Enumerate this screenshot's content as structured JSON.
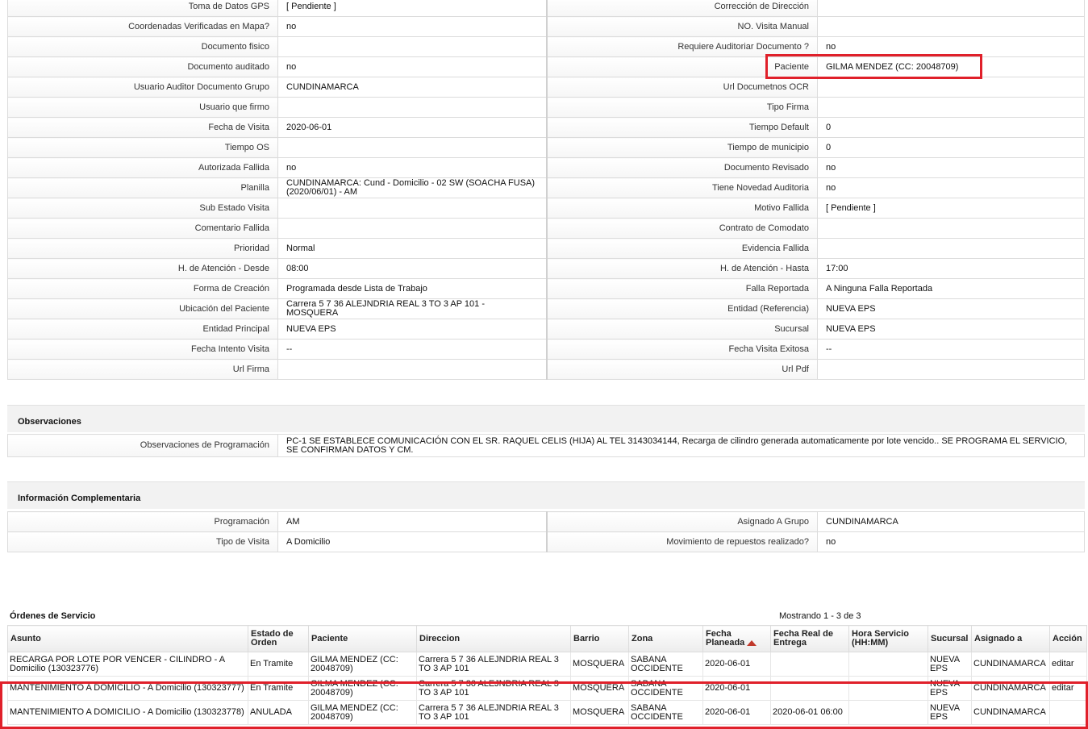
{
  "details_rows": [
    {
      "l1": "Toma de Datos GPS",
      "v1": "[ Pendiente ]",
      "l2": "Corrección de Dirección",
      "v2": ""
    },
    {
      "l1": "Coordenadas Verificadas en Mapa?",
      "v1": "no",
      "l2": "NO. Visita Manual",
      "v2": ""
    },
    {
      "l1": "Documento fisico",
      "v1": "",
      "l2": "Requiere Auditoriar Documento ?",
      "v2": "no"
    },
    {
      "l1": "Documento auditado",
      "v1": "no",
      "l2": "Paciente",
      "v2": "GILMA MENDEZ (CC: 20048709)"
    },
    {
      "l1": "Usuario Auditor Documento Grupo",
      "v1": "CUNDINAMARCA",
      "l2": "Url Documetnos OCR",
      "v2": ""
    },
    {
      "l1": "Usuario que firmo",
      "v1": "",
      "l2": "Tipo Firma",
      "v2": ""
    },
    {
      "l1": "Fecha de Visita",
      "v1": "2020-06-01",
      "l2": "Tiempo Default",
      "v2": "0"
    },
    {
      "l1": "Tiempo OS",
      "v1": "",
      "l2": "Tiempo de municipio",
      "v2": "0"
    },
    {
      "l1": "Autorizada Fallida",
      "v1": "no",
      "l2": "Documento Revisado",
      "v2": "no"
    },
    {
      "l1": "Planilla",
      "v1": "CUNDINAMARCA: Cund - Domicilio - 02 SW (SOACHA FUSA) (2020/06/01) - AM",
      "l2": "Tiene Novedad Auditoria",
      "v2": "no"
    },
    {
      "l1": "Sub Estado Visita",
      "v1": "",
      "l2": "Motivo Fallida",
      "v2": "[ Pendiente ]"
    },
    {
      "l1": "Comentario Fallida",
      "v1": "",
      "l2": "Contrato de Comodato",
      "v2": ""
    },
    {
      "l1": "Prioridad",
      "v1": "Normal",
      "l2": "Evidencia Fallida",
      "v2": ""
    },
    {
      "l1": "H. de Atención - Desde",
      "v1": "08:00",
      "l2": "H. de Atención - Hasta",
      "v2": "17:00"
    },
    {
      "l1": "Forma de Creación",
      "v1": "Programada desde Lista de Trabajo",
      "l2": "Falla Reportada",
      "v2": "A Ninguna Falla Reportada"
    },
    {
      "l1": "Ubicación del Paciente",
      "v1": "Carrera 5 7 36 ALEJNDRIA REAL 3 TO 3 AP 101 - MOSQUERA",
      "l2": "Entidad (Referencia)",
      "v2": "NUEVA EPS"
    },
    {
      "l1": "Entidad Principal",
      "v1": "NUEVA EPS",
      "l2": "Sucursal",
      "v2": "NUEVA EPS"
    },
    {
      "l1": "Fecha Intento Visita",
      "v1": "--",
      "l2": "Fecha Visita Exitosa",
      "v2": "--"
    },
    {
      "l1": "Url Firma",
      "v1": "",
      "l2": "Url Pdf",
      "v2": ""
    }
  ],
  "observaciones": {
    "title": "Observaciones",
    "label": "Observaciones de Programación",
    "value": "PC-1 SE ESTABLECE COMUNICACIÓN CON EL SR. RAQUEL CELIS (HIJA) AL TEL 3143034144, Recarga de cilindro generada automaticamente por lote vencido.. SE PROGRAMA EL SERVICIO, SE CONFIRMAN DATOS Y CM."
  },
  "info": {
    "title": "Información Complementaria",
    "rows": [
      {
        "l1": "Programación",
        "v1": "AM",
        "l2": "Asignado A Grupo",
        "v2": "CUNDINAMARCA"
      },
      {
        "l1": "Tipo de Visita",
        "v1": "A Domicilio",
        "l2": "Movimiento de repuestos realizado?",
        "v2": "no"
      }
    ]
  },
  "orders": {
    "title": "Órdenes de Servicio",
    "showing": "Mostrando 1 - 3 de 3",
    "headers": [
      "Asunto",
      "Estado de Orden",
      "Paciente",
      "Direccion",
      "Barrio",
      "Zona",
      "Fecha Planeada",
      "Fecha Real de Entrega",
      "Hora Servicio (HH:MM)",
      "Sucursal",
      "Asignado a",
      "Acción"
    ],
    "rows": [
      [
        "RECARGA POR LOTE POR VENCER - CILINDRO - A Domicilio (130323776)",
        "En Tramite",
        "GILMA MENDEZ (CC: 20048709)",
        "Carrera 5 7 36 ALEJNDRIA REAL 3 TO 3 AP 101",
        "MOSQUERA",
        "SABANA OCCIDENTE",
        "2020-06-01",
        "",
        "",
        "NUEVA EPS",
        "CUNDINAMARCA",
        "editar"
      ],
      [
        "MANTENIMIENTO A DOMICILIO - A Domicilio (130323777)",
        "En Tramite",
        "GILMA MENDEZ (CC: 20048709)",
        "Carrera 5 7 36 ALEJNDRIA REAL 3 TO 3 AP 101",
        "MOSQUERA",
        "SABANA OCCIDENTE",
        "2020-06-01",
        "",
        "",
        "NUEVA EPS",
        "CUNDINAMARCA",
        "editar"
      ],
      [
        "MANTENIMIENTO A DOMICILIO - A Domicilio (130323778)",
        "ANULADA",
        "GILMA MENDEZ (CC: 20048709)",
        "Carrera 5 7 36 ALEJNDRIA REAL 3 TO 3 AP 101",
        "MOSQUERA",
        "SABANA OCCIDENTE",
        "2020-06-01",
        "2020-06-01 06:00",
        "",
        "NUEVA EPS",
        "CUNDINAMARCA",
        ""
      ]
    ]
  },
  "colors": {
    "highlight": "#e0202a",
    "sort_arrow": "#c0392b"
  },
  "icons": {
    "sort": "sort-ascending-icon"
  }
}
